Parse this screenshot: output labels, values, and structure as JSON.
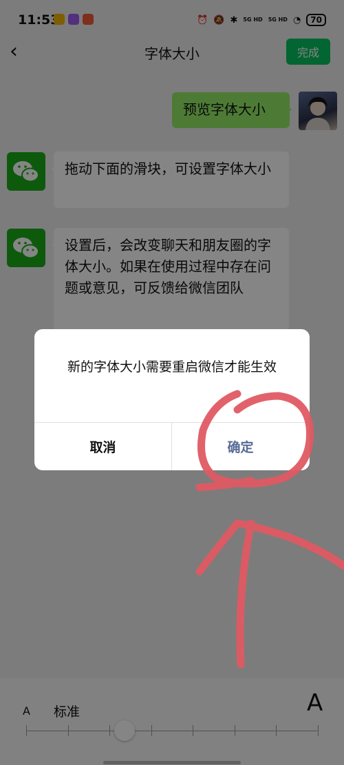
{
  "status_bar": {
    "time": "11:53",
    "net1": "5G HD",
    "net2": "5G HD",
    "battery": "70"
  },
  "nav": {
    "back_glyph": "‹",
    "title": "字体大小",
    "done_label": "完成"
  },
  "chat": {
    "preview_text": "预览字体大小",
    "msg1": "拖动下面的滑块，可设置字体大小",
    "msg2": "设置后，会改变聊天和朋友圈的字体大小。如果在使用过程中存在问题或意见，可反馈给微信团队"
  },
  "dialog": {
    "message": "新的字体大小需要重启微信才能生效",
    "cancel_label": "取消",
    "confirm_label": "确定"
  },
  "font_slider": {
    "small_label": "A",
    "large_label": "A",
    "current_label": "标准",
    "level_index": 2,
    "level_count": 8
  },
  "colors": {
    "accent_green": "#07c160",
    "link_blue": "#576b95",
    "annotation_red": "#e05a63"
  },
  "icons": [
    "back-icon",
    "wechat-logo-icon",
    "bluetooth-icon",
    "wifi-icon",
    "battery-icon"
  ]
}
